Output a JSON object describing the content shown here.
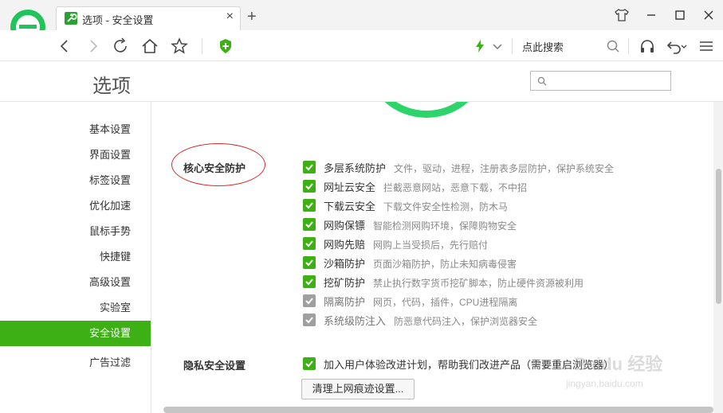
{
  "browser": {
    "tab_title": "选项 - 安全设置",
    "new_tab_symbol": "+",
    "close_symbol": "×",
    "search_hint": "点此搜索",
    "accent_color": "#2ba134",
    "logo_color": "#21c45a"
  },
  "page": {
    "title": "选项",
    "search_placeholder": ""
  },
  "sidebar": {
    "active_color": "#3cb014",
    "items": [
      {
        "label": "基本设置"
      },
      {
        "label": "界面设置"
      },
      {
        "label": "标签设置"
      },
      {
        "label": "优化加速"
      },
      {
        "label": "鼠标手势"
      },
      {
        "label": "快捷键"
      },
      {
        "label": "高级设置"
      },
      {
        "label": "实验室"
      },
      {
        "label": "安全设置",
        "active": true
      },
      {
        "label": "广告过滤"
      }
    ]
  },
  "core_security": {
    "label": "核心安全防护",
    "options": [
      {
        "label": "多层系统防护",
        "desc": "文件，驱动，进程，注册表多层防护，保护系统安全",
        "checked": true,
        "enabled": true
      },
      {
        "label": "网址云安全",
        "desc": "拦截恶意网站，恶意下载，不中招",
        "checked": true,
        "enabled": true
      },
      {
        "label": "下载云安全",
        "desc": "下载文件安全性检测，防木马",
        "checked": true,
        "enabled": true
      },
      {
        "label": "网购保镖",
        "desc": "智能检测网购环境，保障购物安全",
        "checked": true,
        "enabled": true
      },
      {
        "label": "网购先赔",
        "desc": "网购上当受损后，先行赔付",
        "checked": true,
        "enabled": true
      },
      {
        "label": "沙箱防护",
        "desc": "页面沙箱防护，防止未知病毒侵害",
        "checked": true,
        "enabled": true
      },
      {
        "label": "挖矿防护",
        "desc": "禁止执行数字货币挖矿脚本，防止硬件资源被利用",
        "checked": true,
        "enabled": true
      },
      {
        "label": "隔离防护",
        "desc": "网页，代码，插件，CPU进程隔离",
        "checked": true,
        "enabled": false
      },
      {
        "label": "系统级防注入",
        "desc": "防恶意代码注入，保护浏览器安全",
        "checked": true,
        "enabled": false
      }
    ]
  },
  "privacy": {
    "label": "隐私安全设置",
    "option_label": "加入用户体验改进计划，帮助我们改进产品（需要重启浏览器）",
    "option_checked": true,
    "clear_button": "清理上网痕迹设置..."
  },
  "watermark": {
    "main": "Baidu 经验",
    "sub": "jingyan.baidu.com"
  }
}
